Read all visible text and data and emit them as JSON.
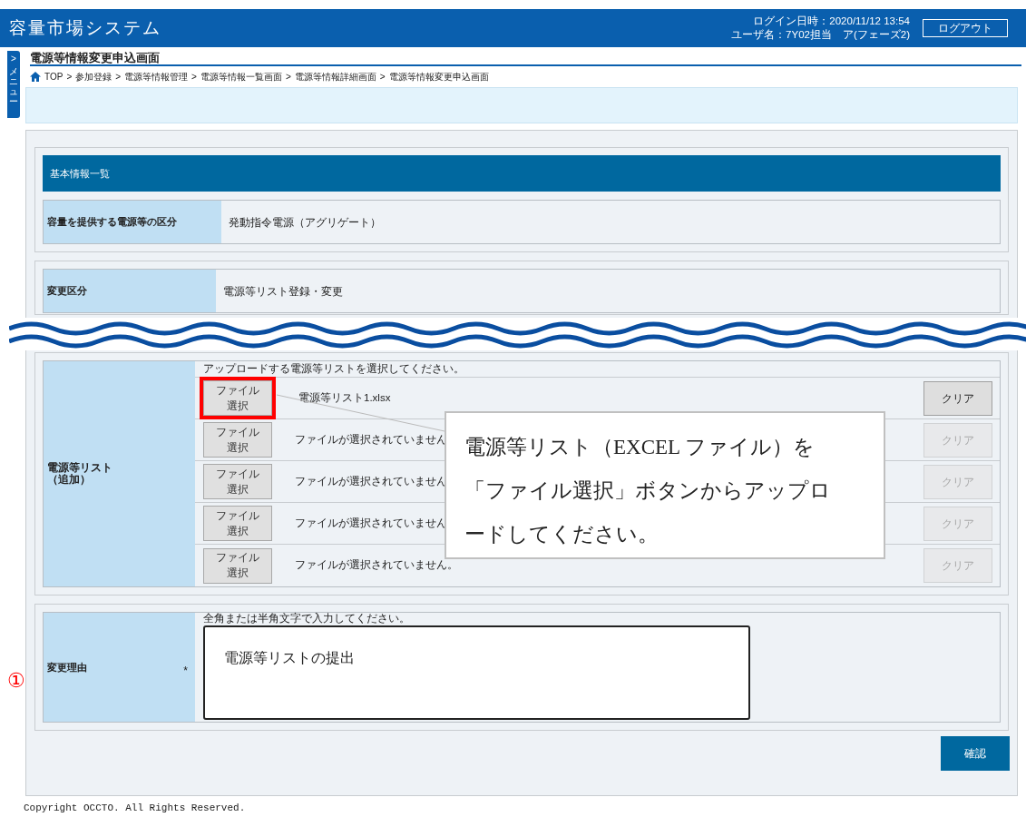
{
  "header": {
    "app_title": "容量市場システム",
    "login_time": "ログイン日時：2020/11/12 13:54",
    "user": "ユーザ名：7Y02担当　ア(フェーズ2)",
    "logout_button": "ログアウト"
  },
  "side_menu": {
    "arrow": ">",
    "label": "メニュー"
  },
  "page_title": "電源等情報変更申込画面",
  "breadcrumb": [
    {
      "label": "TOP"
    },
    {
      "label": "参加登録"
    },
    {
      "label": "電源等情報管理"
    },
    {
      "label": "電源等情報一覧画面"
    },
    {
      "label": "電源等情報詳細画面"
    },
    {
      "label": "電源等情報変更申込画面"
    }
  ],
  "breadcrumb_separator": ">",
  "basic_info": {
    "heading": "基本情報一覧",
    "label": "容量を提供する電源等の区分",
    "value": "発動指令電源（アグリゲート）"
  },
  "change_type": {
    "label": "変更区分",
    "value": "電源等リスト登録・変更"
  },
  "file_list": {
    "label": "電源等リスト（追加）",
    "hint": "アップロードする電源等リストを選択してください。",
    "rows": [
      {
        "button": "ファイル選択",
        "file": "電源等リスト1.xlsx",
        "clear": "クリア",
        "disabled": false
      },
      {
        "button": "ファイル選択",
        "file": "ファイルが選択されていません",
        "clear": "クリア",
        "disabled": true
      },
      {
        "button": "ファイル選択",
        "file": "ファイルが選択されていません",
        "clear": "クリア",
        "disabled": true
      },
      {
        "button": "ファイル選択",
        "file": "ファイルが選択されていません",
        "clear": "クリア",
        "disabled": true
      },
      {
        "button": "ファイル選択",
        "file": "ファイルが選択されていません。",
        "clear": "クリア",
        "disabled": true
      }
    ]
  },
  "reason": {
    "marker": "①",
    "label": "変更理由",
    "required_mark": "*",
    "hint": "全角または半角文字で入力してください。",
    "value": "電源等リストの提出"
  },
  "confirm_button": "確認",
  "copyright": "Copyright OCCTO. All Rights Reserved.",
  "callout": "電源等リスト（EXCEL ファイル）を「ファイル選択」ボタンからアップロードしてください。"
}
